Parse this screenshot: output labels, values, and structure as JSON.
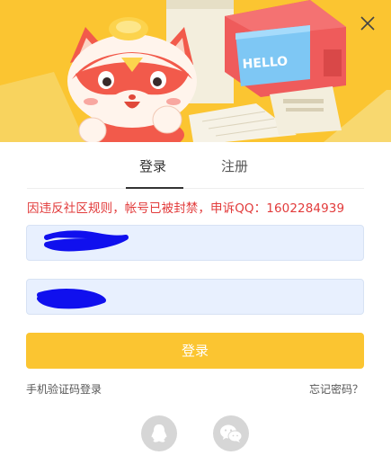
{
  "banner": {
    "monitor_text": "HELLO",
    "colors": {
      "background": "#fbc531",
      "cat": "#f25a4b",
      "monitor": "#ef5b5b"
    }
  },
  "tabs": [
    {
      "label": "登录",
      "active": true
    },
    {
      "label": "注册",
      "active": false
    }
  ],
  "error_message": "因违反社区规则，帐号已被封禁，申诉QQ：1602284939",
  "form": {
    "username_value": "",
    "password_value": "",
    "submit_label": "登录"
  },
  "links": {
    "sms_login": "手机验证码登录",
    "forgot_password": "忘记密码？"
  },
  "social": [
    {
      "icon": "qq-icon"
    },
    {
      "icon": "wechat-icon"
    }
  ],
  "icons": {
    "close": "close-icon"
  },
  "colors": {
    "accent": "#fbc531",
    "error": "#e23b3b",
    "input_bg": "#e8f0fe",
    "social_bg": "#d6d6d6"
  }
}
